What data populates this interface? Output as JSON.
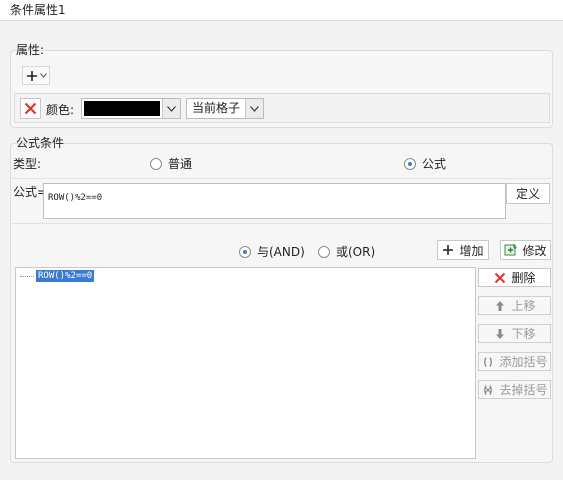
{
  "window": {
    "title": "条件属性1"
  },
  "properties": {
    "section_label": "属性:",
    "add_icon": "plus-dropdown-icon",
    "remove_icon": "red-x-icon",
    "color_label": "颜色:",
    "color_value": "#000000",
    "scope_value": "当前格子"
  },
  "condition": {
    "section_label": "公式条件",
    "type_label": "类型:",
    "type_options": [
      {
        "label": "普通",
        "checked": false
      },
      {
        "label": "公式",
        "checked": true
      }
    ],
    "formula_label": "公式=",
    "formula_value": "ROW()%2==0",
    "define_button": "定义",
    "logic_options": [
      {
        "label": "与(AND)",
        "checked": true
      },
      {
        "label": "或(OR)",
        "checked": false
      }
    ],
    "add_button": "增加",
    "modify_button": "修改",
    "list_items": [
      "ROW()%2==0"
    ],
    "side_buttons": {
      "delete": "删除",
      "move_up": "上移",
      "move_down": "下移",
      "add_bracket": "添加括号",
      "remove_bracket": "去掉括号"
    }
  }
}
